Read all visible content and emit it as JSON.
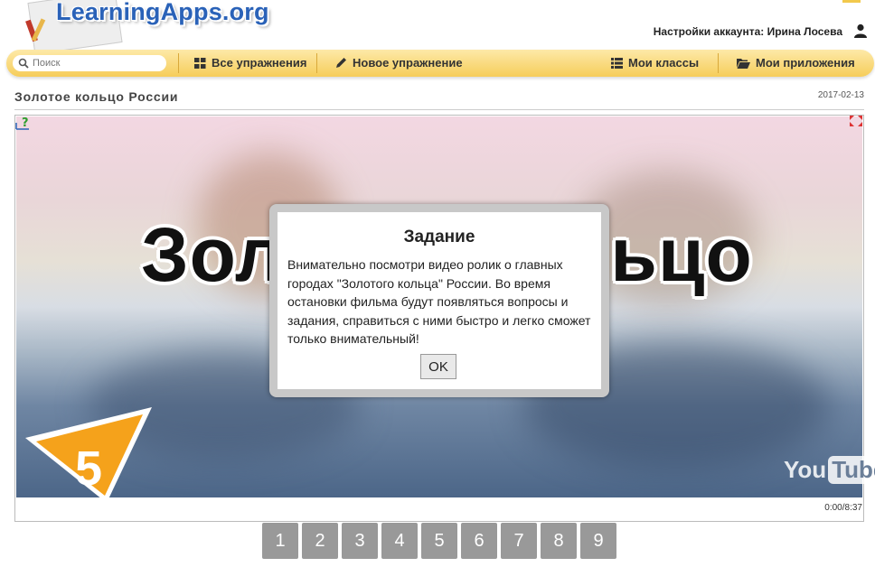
{
  "header": {
    "site_title": "LearningApps.org",
    "account_label": "Настройки аккаунта: Ирина Лосева"
  },
  "navbar": {
    "search_placeholder": "Поиск",
    "all_exercises": "Все упражнения",
    "new_exercise": "Новое упражнение",
    "my_classes": "Мои классы",
    "my_apps": "Мои приложения"
  },
  "page": {
    "title": "Золотое кольцо России",
    "date": "2017-02-13"
  },
  "video": {
    "overlay_title": "Золотое кольцо",
    "badge_number": "5",
    "provider_you": "You",
    "provider_tube": "Tube",
    "time": "0:00/8:37"
  },
  "modal": {
    "title": "Задание",
    "text": "Внимательно посмотри видео ролик о главных городах \"Золотого кольца\" России. Во время остановки фильма будут появляться вопросы и задания, справиться с ними быстро и легко сможет только внимательный!",
    "ok": "OK"
  },
  "pager": {
    "pages": [
      "1",
      "2",
      "3",
      "4",
      "5",
      "6",
      "7",
      "8",
      "9"
    ]
  },
  "colors": {
    "navbar_top": "#fde9a8",
    "navbar_bottom": "#f6cd5a",
    "brand_blue": "#2a62b8",
    "page_button": "#999999",
    "badge_orange": "#f5a21b"
  }
}
